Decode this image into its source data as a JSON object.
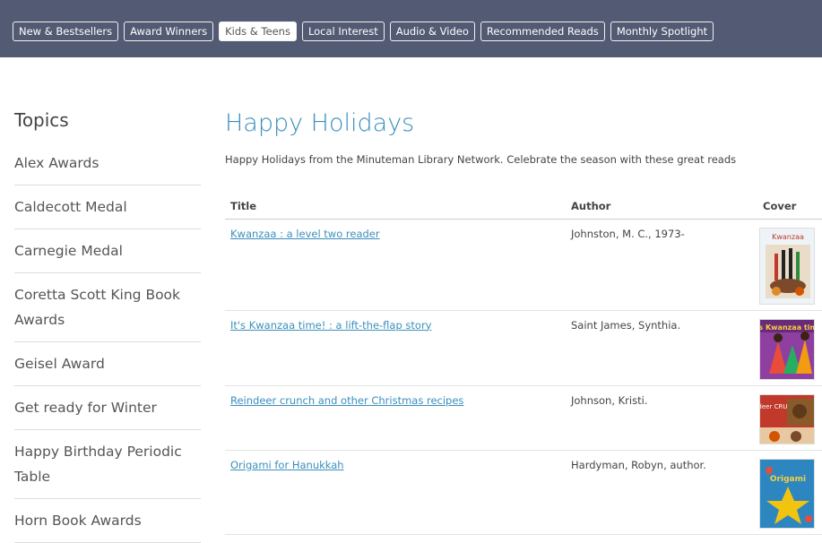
{
  "nav": {
    "items": [
      {
        "label": "New & Bestsellers",
        "active": false
      },
      {
        "label": "Award Winners",
        "active": false
      },
      {
        "label": "Kids & Teens",
        "active": true
      },
      {
        "label": "Local Interest",
        "active": false
      },
      {
        "label": "Audio & Video",
        "active": false
      },
      {
        "label": "Recommended Reads",
        "active": false
      },
      {
        "label": "Monthly Spotlight",
        "active": false
      }
    ]
  },
  "sidebar": {
    "title": "Topics",
    "items": [
      "Alex Awards",
      "Caldecott Medal",
      "Carnegie Medal",
      "Coretta Scott King Book Awards",
      "Geisel Award",
      "Get ready for Winter",
      "Happy Birthday Periodic Table",
      "Horn Book Awards"
    ]
  },
  "main": {
    "title": "Happy Holidays",
    "intro": "Happy Holidays from the Minuteman Library Network.  Celebrate the season with these great reads",
    "columns": {
      "title": "Title",
      "author": "Author",
      "cover": "Cover"
    },
    "rows": [
      {
        "title": "Kwanzaa : a level two reader",
        "author": "Johnston, M. C., 1973-",
        "cover_text": "Kwanzaa"
      },
      {
        "title": "It's Kwanzaa time! : a lift-the-flap story",
        "author": "Saint James, Synthia.",
        "cover_text": "It's Kwanzaa time!"
      },
      {
        "title": "Reindeer crunch and other Christmas recipes",
        "author": "Johnson, Kristi.",
        "cover_text": "Reindeer CRUNCH"
      },
      {
        "title": "Origami for Hanukkah",
        "author": "Hardyman, Robyn, author.",
        "cover_text": "Origami"
      }
    ]
  },
  "colors": {
    "topbar": "#535a73",
    "accent": "#3a8fbd"
  }
}
